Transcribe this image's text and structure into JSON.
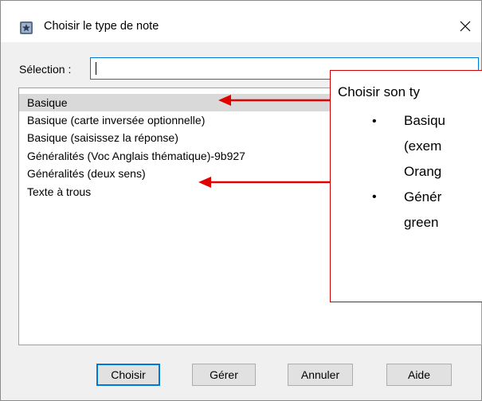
{
  "window": {
    "title": "Choisir le type de note",
    "close_glyph": "✕",
    "app_icon": "anki-app-icon"
  },
  "selection": {
    "label": "Sélection :",
    "value": ""
  },
  "list": {
    "items": [
      {
        "label": "Basique",
        "selected": true
      },
      {
        "label": "Basique (carte inversée optionnelle)",
        "selected": false
      },
      {
        "label": "Basique (saisissez la réponse)",
        "selected": false
      },
      {
        "label": "Généralités (Voc Anglais thématique)-9b927",
        "selected": false
      },
      {
        "label": "Généralités (deux sens)",
        "selected": false
      },
      {
        "label": "Texte à trous",
        "selected": false
      }
    ]
  },
  "buttons": {
    "choose": "Choisir",
    "manage": "Gérer",
    "cancel": "Annuler",
    "help": "Aide"
  },
  "callout": {
    "line1": "Choisir son ty",
    "b1_line1": "Basiqu",
    "b1_line2": "(exem",
    "b1_line3": "Orang",
    "b2_line1": "Génér",
    "b2_line2": "green",
    "bullet_glyph": "•",
    "border_color": "#d00000",
    "arrow_color": "#e00000"
  },
  "colors": {
    "focus_blue": "#0078d7",
    "selected_row": "#d9d9d9"
  }
}
